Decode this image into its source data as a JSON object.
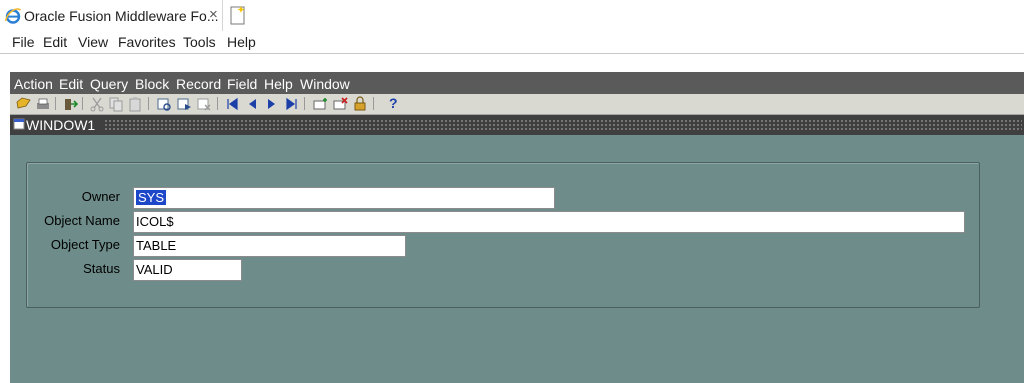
{
  "browser": {
    "tab_title": "Oracle Fusion Middleware Fo...",
    "tab_close": "×",
    "menu": [
      "File",
      "Edit",
      "View",
      "Favorites",
      "Tools",
      "Help"
    ]
  },
  "forms": {
    "menu": [
      "Action",
      "Edit",
      "Query",
      "Block",
      "Record",
      "Field",
      "Help",
      "Window"
    ],
    "window_title": "WINDOW1",
    "toolbar_help": "?",
    "fields": {
      "owner": {
        "label": "Owner",
        "value": "SYS"
      },
      "object_name": {
        "label": "Object Name",
        "value": "ICOL$"
      },
      "object_type": {
        "label": "Object Type",
        "value": "TABLE"
      },
      "status": {
        "label": "Status",
        "value": "VALID"
      }
    }
  },
  "colors": {
    "canvas": "#6e8c89",
    "forms_menubar": "#5a5a5a",
    "selection": "#1c47c9"
  }
}
